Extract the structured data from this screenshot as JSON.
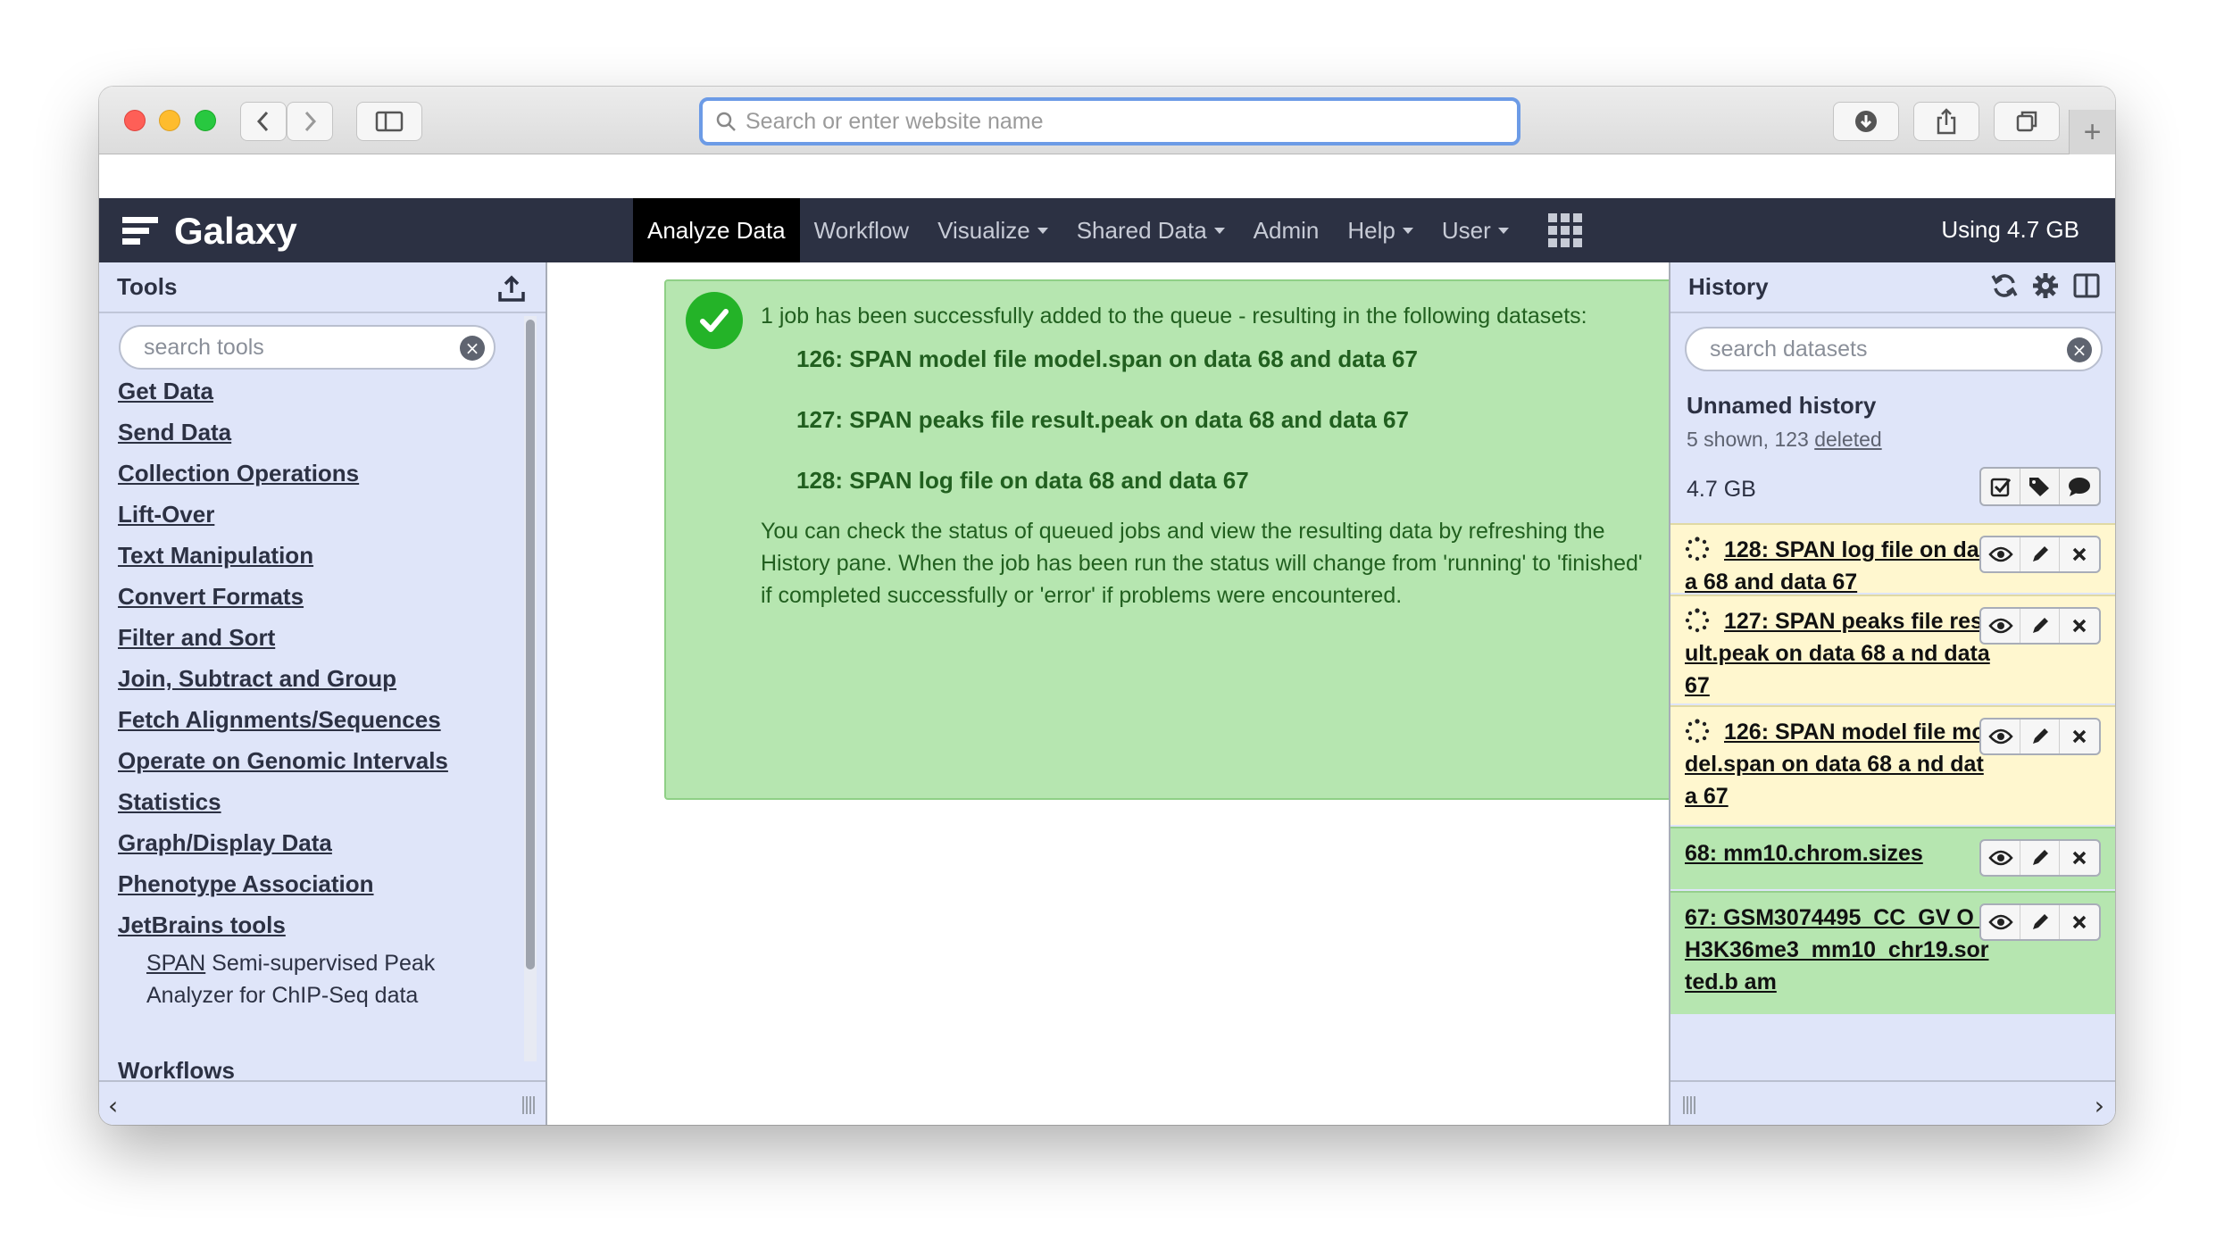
{
  "browser": {
    "url_placeholder": "Search or enter website name",
    "new_tab_label": "+"
  },
  "masthead": {
    "brand": "Galaxy",
    "nav": [
      {
        "label": "Analyze Data",
        "active": true
      },
      {
        "label": "Workflow"
      },
      {
        "label": "Visualize",
        "dropdown": true
      },
      {
        "label": "Shared Data",
        "dropdown": true
      },
      {
        "label": "Admin"
      },
      {
        "label": "Help",
        "dropdown": true
      },
      {
        "label": "User",
        "dropdown": true
      }
    ],
    "quota": "Using 4.7 GB"
  },
  "tools": {
    "title": "Tools",
    "search_placeholder": "search tools",
    "sections": [
      "Get Data",
      "Send Data",
      "Collection Operations",
      "Lift-Over",
      "Text Manipulation",
      "Convert Formats",
      "Filter and Sort",
      "Join, Subtract and Group",
      "Fetch Alignments/Sequences",
      "Operate on Genomic Intervals",
      "Statistics",
      "Graph/Display Data",
      "Phenotype Association",
      "JetBrains tools"
    ],
    "subtool_link": "SPAN",
    "subtool_desc_1": " Semi-supervised Peak",
    "subtool_desc_2": "Analyzer for ChIP-Seq data",
    "workflows_label": "Workflows"
  },
  "center": {
    "message": "1 job has been successfully added to the queue - resulting in the following datasets:",
    "datasets": [
      "126: SPAN model file model.span on data 68 and data 67",
      "127: SPAN peaks file result.peak on data 68 and data 67",
      "128: SPAN log file on data 68 and data 67"
    ],
    "note_line1": "You can check the status of queued jobs and view the resulting data by refreshing the",
    "note_line2": "History pane. When the job has been run the status will change from 'running' to 'finished'",
    "note_line3": "if completed successfully or 'error' if problems were encountered."
  },
  "history": {
    "title": "History",
    "search_placeholder": "search datasets",
    "name": "Unnamed history",
    "counts": "5 shown, 123 ",
    "deleted_link": "deleted",
    "size": "4.7 GB",
    "items": [
      {
        "title": "128: SPAN log file on data 68 and data 67 ",
        "state": "queued"
      },
      {
        "title": "127: SPAN peaks file result.peak on data 68 a nd data 67 ",
        "state": "queued"
      },
      {
        "title": "126: SPAN model file model.span on data 68 a nd data 67 ",
        "state": "queued"
      },
      {
        "title": "68: mm10.chrom.sizes ",
        "state": "ok"
      },
      {
        "title": "67: GSM3074495_CC_GV O_H3K36me3_mm10_chr19.sorted.b am ",
        "state": "ok"
      }
    ]
  },
  "colors": {
    "masthead_bg": "#2c3143",
    "panel_bg": "#dfe5f9",
    "success_bg": "#b6e6b0",
    "queued_bg": "#fff7cf",
    "success_icon": "#24b328"
  },
  "icons": {
    "back": "chevron-left-icon",
    "forward": "chevron-right-icon",
    "sidebar": "sidebar-icon",
    "download": "download-icon",
    "share": "share-icon",
    "tabs": "tabs-icon",
    "upload": "upload-icon",
    "refresh": "refresh-icon",
    "gear": "gear-icon",
    "columns": "columns-icon",
    "eye": "eye-icon",
    "pencil": "pencil-icon",
    "delete": "close-icon"
  }
}
